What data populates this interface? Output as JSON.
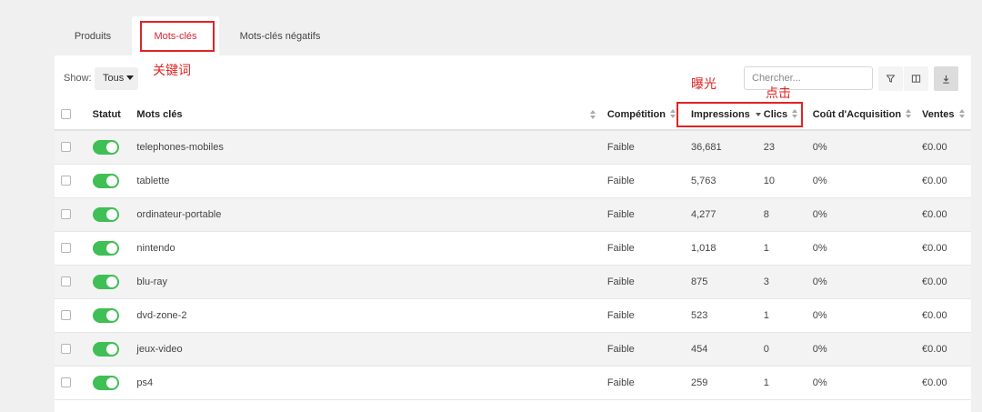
{
  "tabs": [
    {
      "label": "Produits",
      "active": false
    },
    {
      "label": "Mots-clés",
      "active": true
    },
    {
      "label": "Mots-clés négatifs",
      "active": false
    }
  ],
  "annotations": {
    "keywords": "关键词",
    "impressions": "曝光",
    "clicks": "点击"
  },
  "toolbar": {
    "show_label": "Show:",
    "show_value": "Tous",
    "search_placeholder": "Chercher...",
    "icons": [
      "filter-icon",
      "columns-icon",
      "download-icon"
    ]
  },
  "table": {
    "headers": {
      "status": "Statut",
      "keyword": "Mots clés",
      "competition": "Compétition",
      "impressions": "Impressions",
      "clicks": "Clics",
      "acquisition_cost": "Coût d'Acquisition",
      "sales": "Ventes"
    },
    "rows": [
      {
        "keyword": "telephones-mobiles",
        "competition": "Faible",
        "impressions": "36,681",
        "clicks": "23",
        "cost": "0%",
        "sales": "€0.00",
        "enabled": true
      },
      {
        "keyword": "tablette",
        "competition": "Faible",
        "impressions": "5,763",
        "clicks": "10",
        "cost": "0%",
        "sales": "€0.00",
        "enabled": true
      },
      {
        "keyword": "ordinateur-portable",
        "competition": "Faible",
        "impressions": "4,277",
        "clicks": "8",
        "cost": "0%",
        "sales": "€0.00",
        "enabled": true
      },
      {
        "keyword": "nintendo",
        "competition": "Faible",
        "impressions": "1,018",
        "clicks": "1",
        "cost": "0%",
        "sales": "€0.00",
        "enabled": true
      },
      {
        "keyword": "blu-ray",
        "competition": "Faible",
        "impressions": "875",
        "clicks": "3",
        "cost": "0%",
        "sales": "€0.00",
        "enabled": true
      },
      {
        "keyword": "dvd-zone-2",
        "competition": "Faible",
        "impressions": "523",
        "clicks": "1",
        "cost": "0%",
        "sales": "€0.00",
        "enabled": true
      },
      {
        "keyword": "jeux-video",
        "competition": "Faible",
        "impressions": "454",
        "clicks": "0",
        "cost": "0%",
        "sales": "€0.00",
        "enabled": true
      },
      {
        "keyword": "ps4",
        "competition": "Faible",
        "impressions": "259",
        "clicks": "1",
        "cost": "0%",
        "sales": "€0.00",
        "enabled": true
      }
    ]
  },
  "colors": {
    "accent": "#d9232d",
    "annotation": "#e02424",
    "toggle_on": "#3fbf55"
  }
}
